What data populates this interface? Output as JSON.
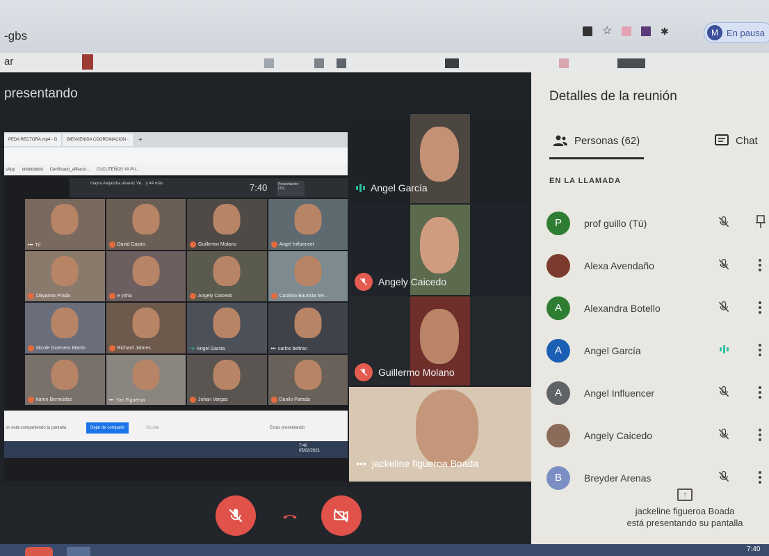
{
  "browser": {
    "tab_title": "-gbs",
    "address_prefix": "ar",
    "profile_initial": "M",
    "profile_status": "En pausa"
  },
  "stage": {
    "presenting_label": "presentando"
  },
  "shared_screen": {
    "tabs": [
      "PEDA RECTORA.mp4 - G",
      "BIENVENIDA COORDINACION - ",
      "+"
    ],
    "bookmarks": [
      "sApp",
      "ddddddddd",
      "Certificado_afiliacio...",
      "CUCUTEÑOS YA PU..."
    ],
    "meet_time": "7:40",
    "mini_participant": "mayra Alejandra alvarez Ve... y 44 más",
    "mini_presentation": "Presentación (Tú)",
    "tiles": [
      {
        "name": "Tú",
        "dots": true
      },
      {
        "name": "David Castro",
        "muted": true
      },
      {
        "name": "Guillermo Molano",
        "muted": true
      },
      {
        "name": "Angel Influencer",
        "muted": true
      },
      {
        "name": "Dayanna Prada",
        "muted": true
      },
      {
        "name": "e yoha",
        "muted": true
      },
      {
        "name": "Angely Caicedo",
        "muted": true
      },
      {
        "name": "Catalina Bautista her...",
        "muted": true
      },
      {
        "name": "Nicole Guerrero Martin",
        "muted": true
      },
      {
        "name": "Richard Jaimes",
        "muted": true
      },
      {
        "name": "Angel Garcia",
        "speaking": true
      },
      {
        "name": "carlos beltran",
        "dots": true
      },
      {
        "name": "karen Bermúdez",
        "muted": true
      },
      {
        "name": "Yan Figueroa",
        "dots": true
      },
      {
        "name": "Johan Vargas",
        "muted": true
      },
      {
        "name": "Danilo Parada",
        "muted": true
      }
    ],
    "footer_note": "on está compartiendo tu pantalla",
    "stop_sharing": "Dejar de compartir",
    "hide": "Ocultar",
    "presenting": "Estás presentando",
    "clock_time": "7:40",
    "clock_date": "05/02/2021"
  },
  "video_strip": [
    {
      "name": "Angel García",
      "state": "speaking"
    },
    {
      "name": "Angely Caicedo",
      "state": "muted"
    },
    {
      "name": "Guillermo Molano",
      "state": "muted"
    }
  ],
  "featured": {
    "name": "jackeline figueroa Boada"
  },
  "panel": {
    "title": "Detalles de la reunión",
    "people_tab": "Personas (62)",
    "chat_tab": "Chat",
    "section_label": "EN LA LLAMADA",
    "participants": [
      {
        "initial": "P",
        "name": "prof guillo (Tú)",
        "color": "#2e7d32",
        "state": "muted",
        "action": "pin"
      },
      {
        "initial": "",
        "name": "Alexa Avendaño",
        "color": "#7a3b2e",
        "state": "muted",
        "action": "more"
      },
      {
        "initial": "A",
        "name": "Alexandra Botello",
        "color": "#2e7d32",
        "state": "muted",
        "action": "more"
      },
      {
        "initial": "A",
        "name": "Angel García",
        "color": "#1a5fb4",
        "state": "speaking",
        "action": "more"
      },
      {
        "initial": "A",
        "name": "Angel Influencer",
        "color": "#5f6368",
        "state": "muted",
        "action": "more"
      },
      {
        "initial": "",
        "name": "Angely Caicedo",
        "color": "#8b6b5a",
        "state": "muted",
        "action": "more"
      },
      {
        "initial": "B",
        "name": "Breyder Arenas",
        "color": "#7b8fc4",
        "state": "muted",
        "action": "more"
      }
    ],
    "presenting_note_line1": "jackeline figueroa Boada",
    "presenting_note_line2": "está presentando su pantalla"
  },
  "taskbar": {
    "clock": "7:40"
  },
  "colors": {
    "mute_red": "#e0524a",
    "speaking_green": "#2fbfa0"
  }
}
